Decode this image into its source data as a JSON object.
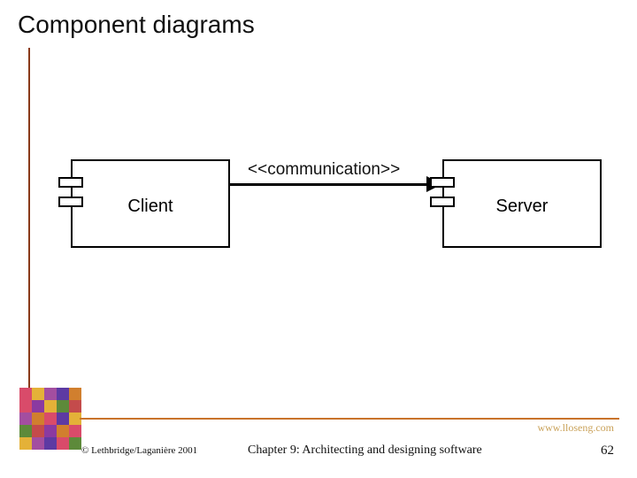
{
  "slide": {
    "title": "Component diagrams"
  },
  "diagram": {
    "left_component": "Client",
    "right_component": "Server",
    "connector_label": "<<communication>>"
  },
  "footer": {
    "website": "www.lloseng.com",
    "copyright": "© Lethbridge/Laganière 2001",
    "chapter": "Chapter 9: Architecting and designing software",
    "page": "62"
  },
  "deco_colors": [
    "#d94b6a",
    "#e4b138",
    "#a34ea0",
    "#5d3aa3",
    "#d17f2e",
    "#d94b6a",
    "#8b3aa1",
    "#e4b138",
    "#5d8a3a",
    "#c44b4b",
    "#a34ea0",
    "#d17f2e",
    "#d94b6a",
    "#5d3aa3",
    "#e4b138",
    "#5d8a3a",
    "#c44b4b",
    "#8b3aa1",
    "#d17f2e",
    "#d94b6a",
    "#e4b138",
    "#a34ea0",
    "#5d3aa3",
    "#d94b6a",
    "#5d8a3a"
  ]
}
